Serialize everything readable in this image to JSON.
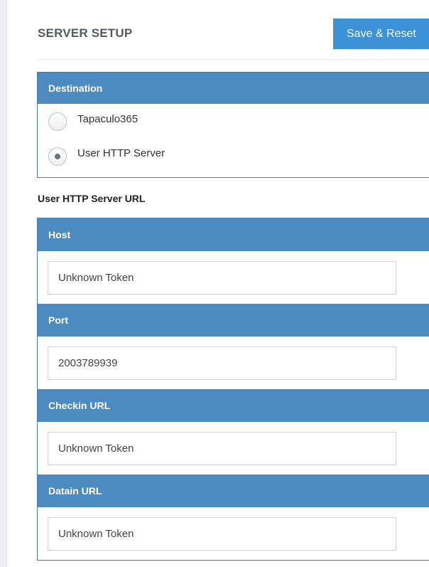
{
  "header": {
    "title": "SERVER SETUP",
    "save_reset_label": "Save & Reset"
  },
  "destination": {
    "heading": "Destination",
    "options": [
      {
        "label": "Tapaculo365",
        "selected": false
      },
      {
        "label": "User HTTP Server",
        "selected": true
      }
    ]
  },
  "user_http": {
    "section_label": "User HTTP Server URL",
    "fields": [
      {
        "label": "Host",
        "value": "Unknown Token"
      },
      {
        "label": "Port",
        "value": "2003789939"
      },
      {
        "label": "Checkin URL",
        "value": "Unknown Token"
      },
      {
        "label": "Datain URL",
        "value": "Unknown Token"
      }
    ]
  },
  "colors": {
    "accent_button": "#3d91d6",
    "panel_header": "#4c8bbf"
  }
}
